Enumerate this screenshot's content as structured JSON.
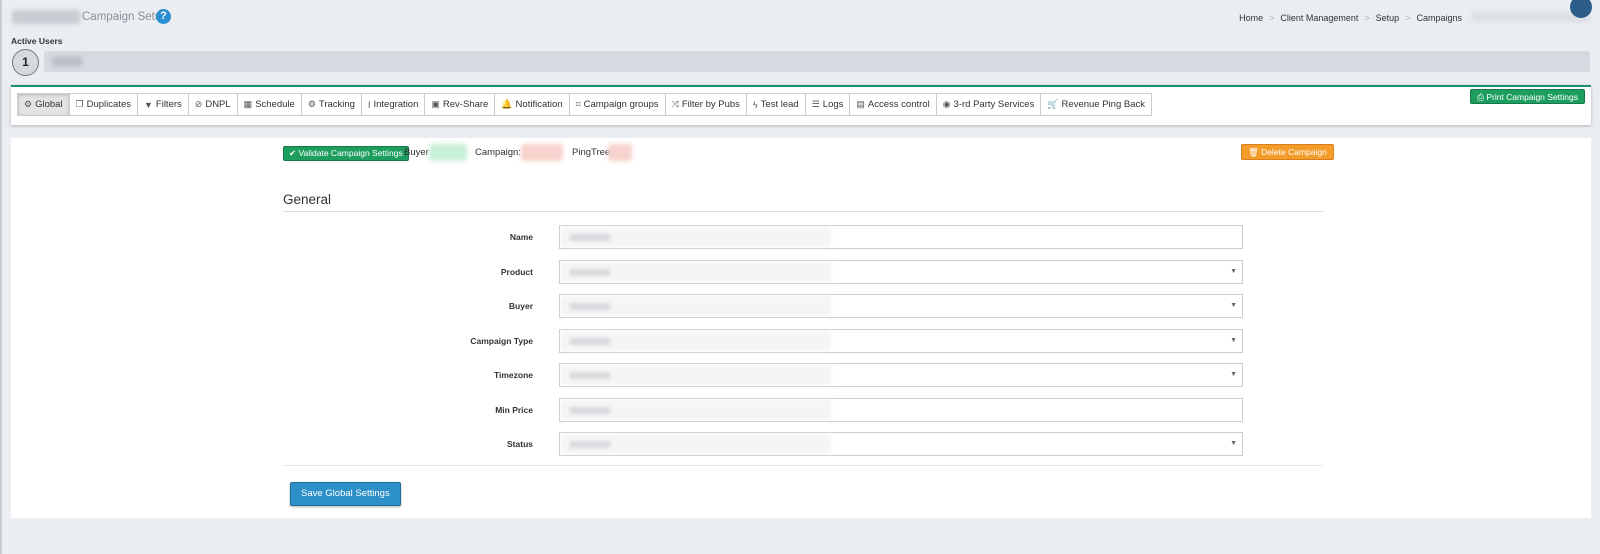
{
  "header": {
    "page_title": "Campaign Setup",
    "help_icon": "?",
    "breadcrumb": [
      "Home",
      "Client Management",
      "Setup",
      "Campaigns"
    ],
    "breadcrumb_sep": ">"
  },
  "active_users": {
    "label": "Active Users",
    "count": "1"
  },
  "tabs": [
    {
      "label": "Global",
      "icon": "cogs-icon",
      "glyph": "⚙",
      "active": true
    },
    {
      "label": "Duplicates",
      "icon": "copy-icon",
      "glyph": "❐"
    },
    {
      "label": "Filters",
      "icon": "filter-icon",
      "glyph": "▼"
    },
    {
      "label": "DNPL",
      "icon": "ban-icon",
      "glyph": "⊘"
    },
    {
      "label": "Schedule",
      "icon": "calendar-icon",
      "glyph": "▦"
    },
    {
      "label": "Tracking",
      "icon": "cogs-icon",
      "glyph": "⚙"
    },
    {
      "label": "Integration",
      "icon": "i-cursor-icon",
      "glyph": "I"
    },
    {
      "label": "Rev-Share",
      "icon": "money-icon",
      "glyph": "▣"
    },
    {
      "label": "Notification",
      "icon": "bell-icon",
      "glyph": "🔔"
    },
    {
      "label": "Campaign groups",
      "icon": "object-group-icon",
      "glyph": "⌗"
    },
    {
      "label": "Filter by Pubs",
      "icon": "random-icon",
      "glyph": "⤨"
    },
    {
      "label": "Test lead",
      "icon": "bolt-icon",
      "glyph": "ϟ"
    },
    {
      "label": "Logs",
      "icon": "list-icon",
      "glyph": "☰"
    },
    {
      "label": "Access control",
      "icon": "file-icon",
      "glyph": "▤"
    },
    {
      "label": "3-rd Party Services",
      "icon": "eye-icon",
      "glyph": "◉"
    },
    {
      "label": "Revenue Ping Back",
      "icon": "cart-icon",
      "glyph": "🛒"
    }
  ],
  "toolbar": {
    "print_label": "Print Campaign Settings"
  },
  "status": {
    "validate_label": "Validate Campaign Settings",
    "buyer_label": "Buyer",
    "campaign_label": "Campaign:",
    "pingtree_label": "PingTree:",
    "delete_label": "Delete Campaign",
    "colors": {
      "buyer": "#c8efd9",
      "campaign": "#f8d2cc",
      "pingtree": "#f8d2cc"
    }
  },
  "section": {
    "title": "General"
  },
  "form": [
    {
      "label": "Name",
      "type": "text"
    },
    {
      "label": "Product",
      "type": "select"
    },
    {
      "label": "Buyer",
      "type": "select"
    },
    {
      "label": "Campaign Type",
      "type": "select"
    },
    {
      "label": "Timezone",
      "type": "select"
    },
    {
      "label": "Min Price",
      "type": "text"
    },
    {
      "label": "Status",
      "type": "select"
    }
  ],
  "save_label": "Save Global Settings"
}
